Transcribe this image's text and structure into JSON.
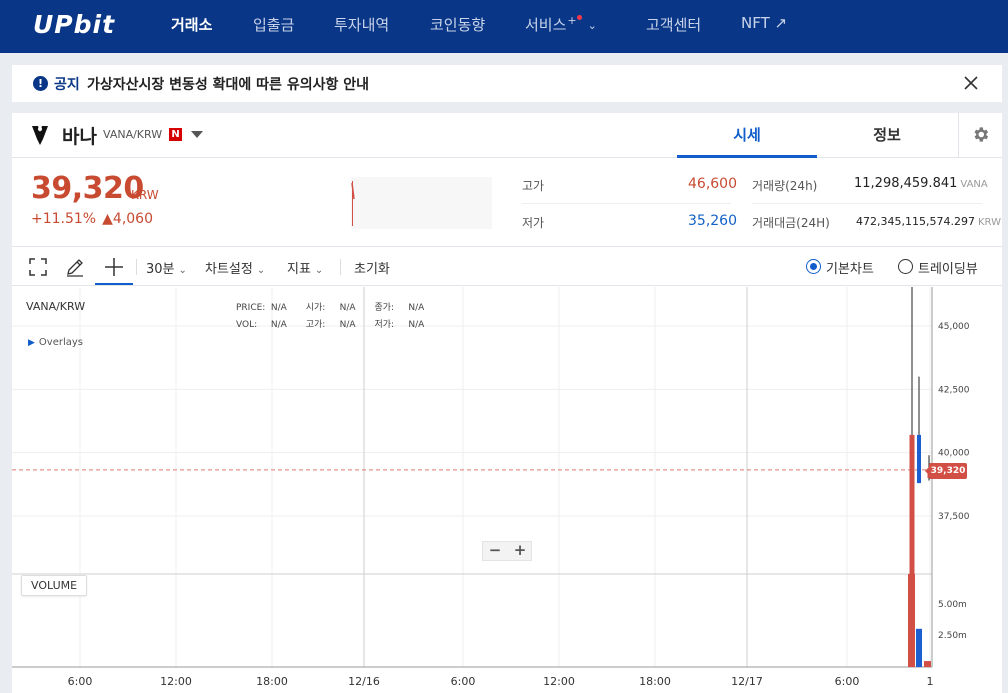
{
  "nav": {
    "logo": "UPbit",
    "items": [
      {
        "label": "거래소",
        "active": true
      },
      {
        "label": "입출금"
      },
      {
        "label": "투자내역"
      },
      {
        "label": "코인동향"
      },
      {
        "label": "서비스"
      },
      {
        "label": "고객센터"
      },
      {
        "label": "NFT ↗"
      }
    ],
    "service_plus": "+"
  },
  "notice": {
    "label": "공지",
    "text": "가상자산시장 변동성 확대에 따른 유의사항 안내"
  },
  "coin": {
    "name": "바나",
    "pair": "VANA/KRW",
    "badge": "N"
  },
  "tabs": [
    {
      "label": "시세",
      "active": true
    },
    {
      "label": "정보"
    }
  ],
  "summary": {
    "price": "39,320",
    "unit": "KRW",
    "change_pct": "+11.51%",
    "change_arrow": "▲",
    "change_amount": "4,060",
    "high_label": "고가",
    "high_value": "46,600",
    "low_label": "저가",
    "low_value": "35,260",
    "volume_label": "거래량(24h)",
    "volume_value": "11,298,459.841",
    "volume_unit": "VANA",
    "turnover_label": "거래대금(24H)",
    "turnover_value": "472,345,115,574.297",
    "turnover_unit": "KRW"
  },
  "toolbar": {
    "interval": "30분",
    "chart_settings": "차트설정",
    "indicators": "지표",
    "reset": "초기화",
    "basic_chart": "기본차트",
    "tradingview": "트레이딩뷰"
  },
  "chart": {
    "symbol": "VANA/KRW",
    "overlays": "Overlays",
    "ohlc": {
      "price_label": "PRICE:",
      "price": "N/A",
      "open_label": "시가:",
      "open": "N/A",
      "close_label": "종가:",
      "close": "N/A",
      "vol_label": "VOL:",
      "vol": "N/A",
      "high_label": "고가:",
      "high": "N/A",
      "low_label": "저가:",
      "low": "N/A"
    },
    "zoom_out": "−",
    "zoom_in": "+",
    "volume_tag": "VOLUME",
    "current_price_tag": "39,320"
  },
  "chart_data": {
    "type": "bar",
    "price_axis": {
      "ticks": [
        "45,000",
        "42,500",
        "40,000",
        "37,500"
      ],
      "tick_values": [
        45000,
        42500,
        40000,
        37500
      ]
    },
    "volume_axis": {
      "ticks": [
        "5.00m",
        "2.50m"
      ],
      "tick_values": [
        5000000,
        2500000
      ]
    },
    "time_axis": {
      "ticks": [
        "6:00",
        "12:00",
        "18:00",
        "12/16",
        "6:00",
        "12:00",
        "18:00",
        "12/17",
        "6:00",
        "1"
      ]
    },
    "current_price": 39320,
    "candles": [
      {
        "open": 35260,
        "high": 46600,
        "low": 35260,
        "close": 40700,
        "color": "#d24f45"
      },
      {
        "open": 40700,
        "high": 43000,
        "low": 38800,
        "close": 38800,
        "color": "#1c5fd0"
      },
      {
        "open": 39000,
        "high": 39900,
        "low": 38900,
        "close": 39320,
        "color": "#d24f45"
      }
    ],
    "volumes": [
      {
        "value": 8200000,
        "color": "#d24f45"
      },
      {
        "value": 3000000,
        "color": "#1c5fd0"
      },
      {
        "value": 400000,
        "color": "#d24f45"
      }
    ]
  }
}
